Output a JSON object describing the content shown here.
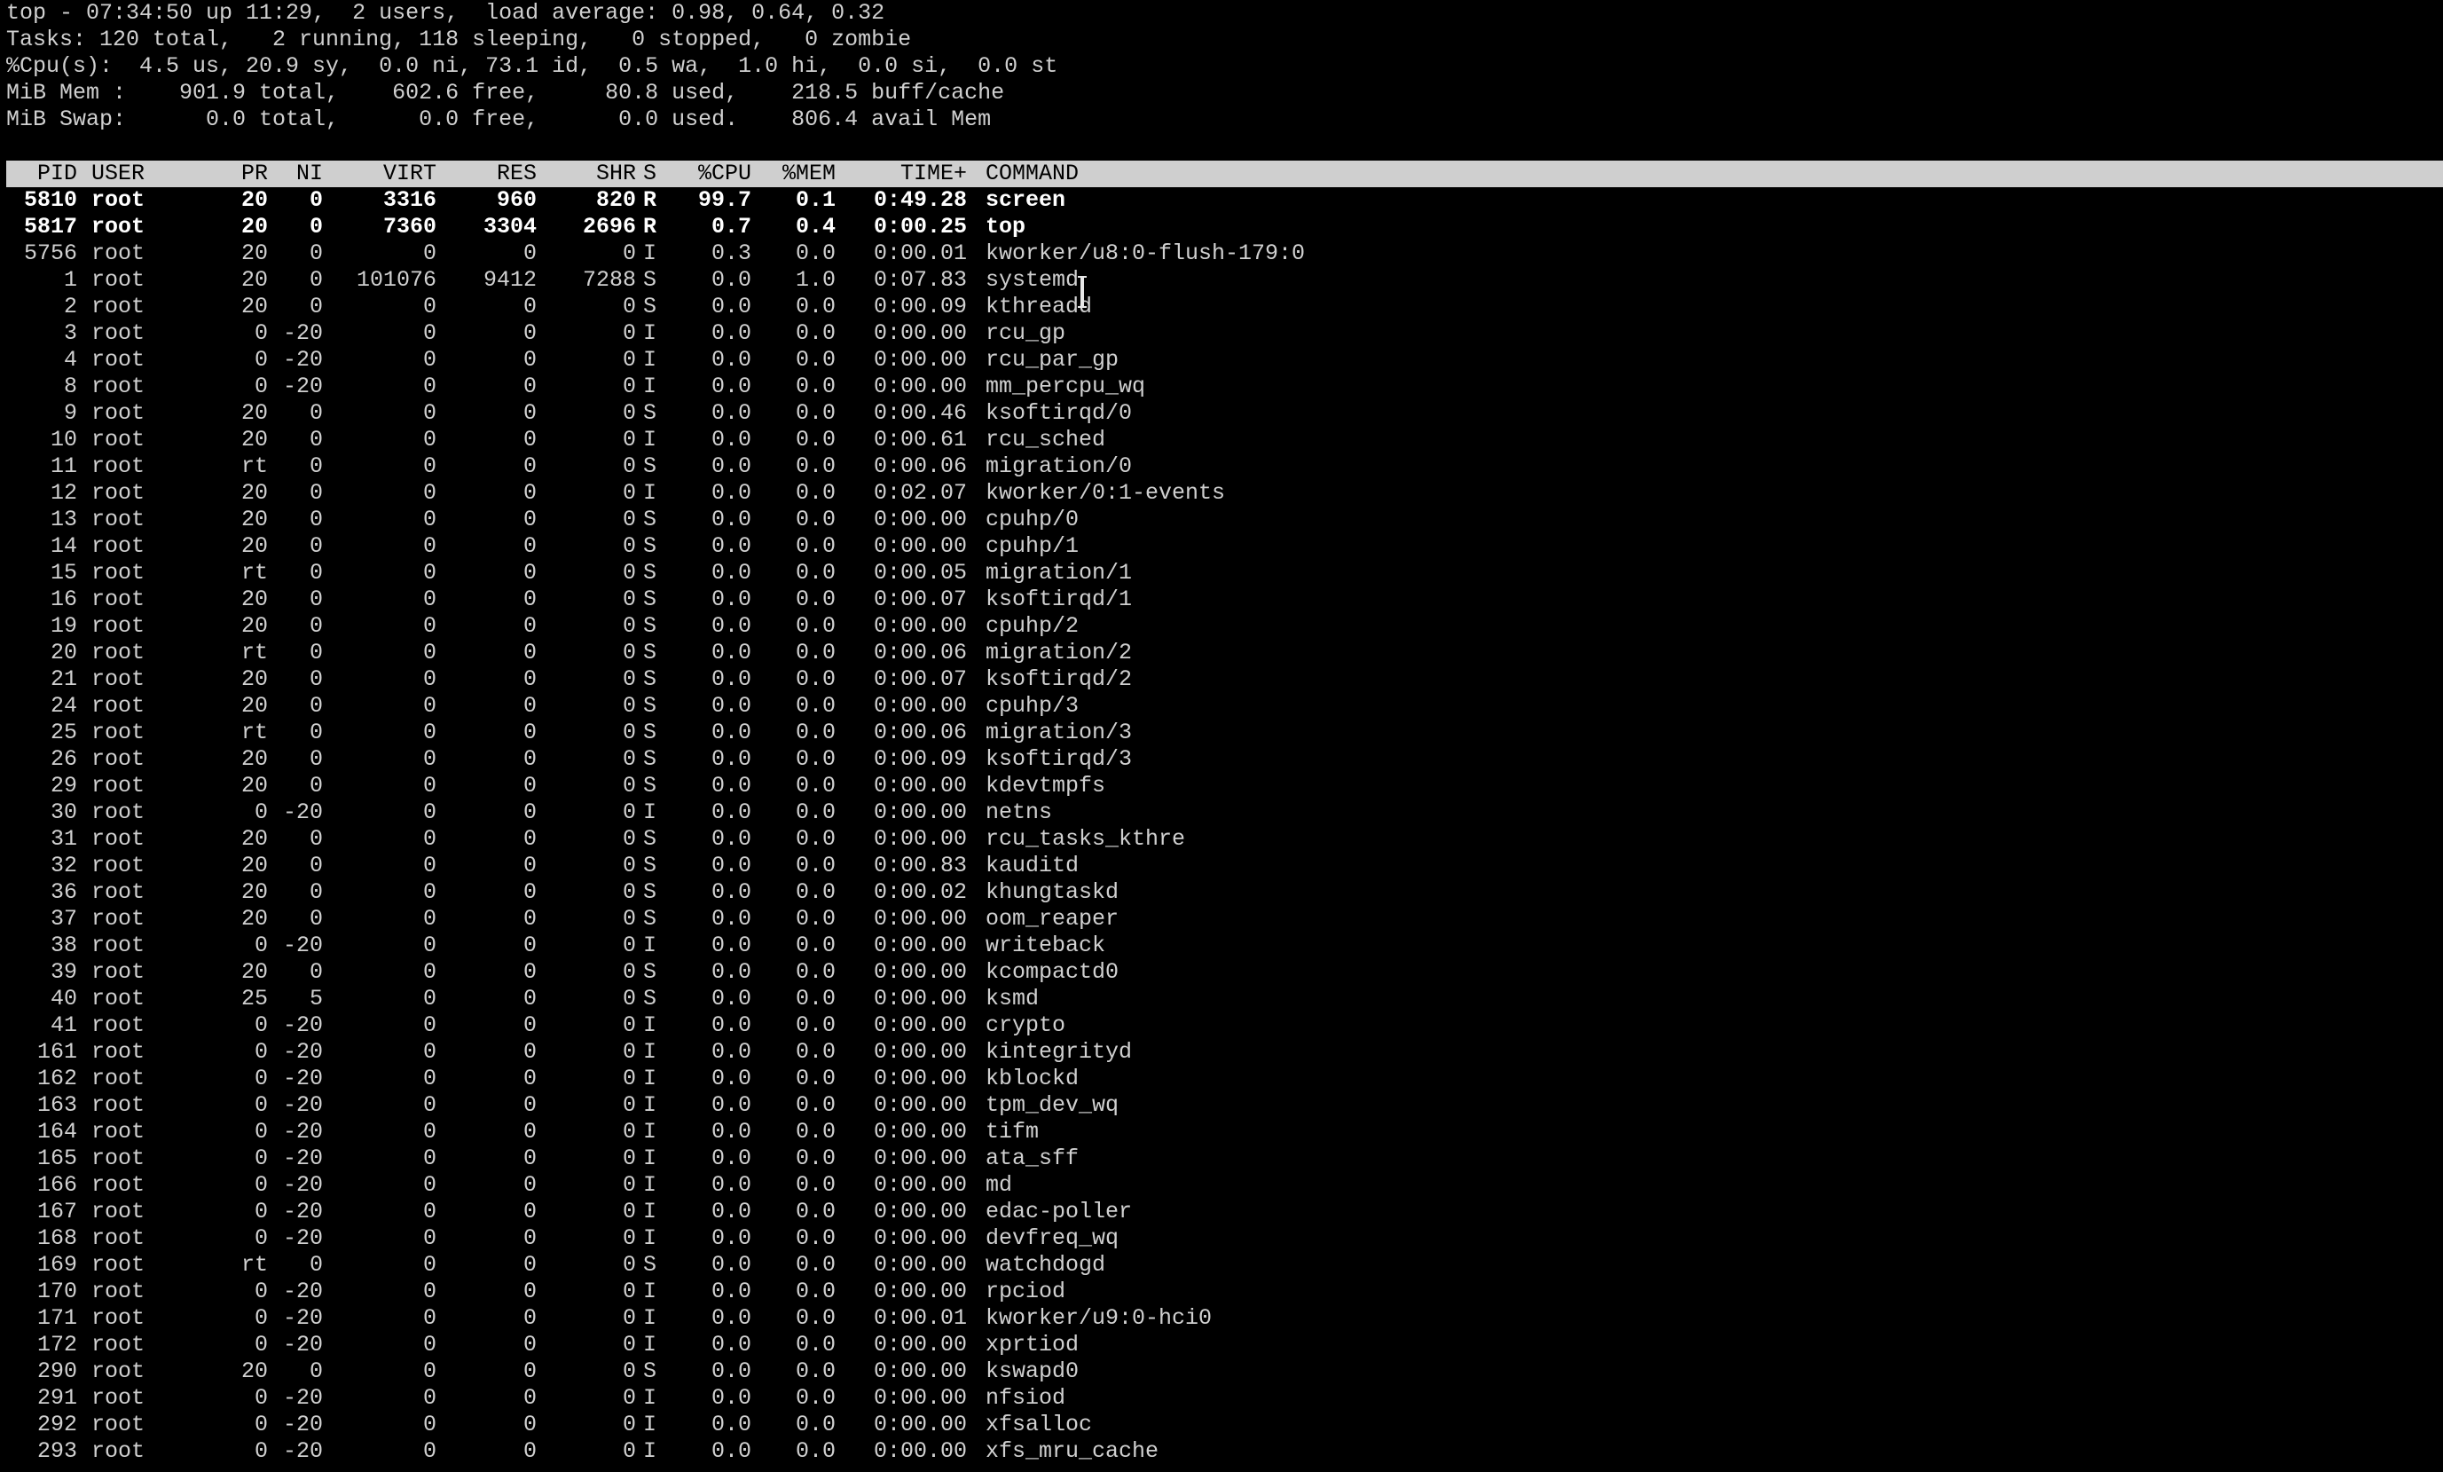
{
  "summary": {
    "line1": "top - 07:34:50 up 11:29,  2 users,  load average: 0.98, 0.64, 0.32",
    "line2": "Tasks: 120 total,   2 running, 118 sleeping,   0 stopped,   0 zombie",
    "line3": "%Cpu(s):  4.5 us, 20.9 sy,  0.0 ni, 73.1 id,  0.5 wa,  1.0 hi,  0.0 si,  0.0 st",
    "line4": "MiB Mem :    901.9 total,    602.6 free,     80.8 used,    218.5 buff/cache",
    "line5": "MiB Swap:      0.0 total,      0.0 free,      0.0 used.    806.4 avail Mem"
  },
  "columns": {
    "pid": "PID",
    "user": "USER",
    "pr": "PR",
    "ni": "NI",
    "virt": "VIRT",
    "res": "RES",
    "shr": "SHR",
    "s": "S",
    "cpu": "%CPU",
    "mem": "%MEM",
    "time": "TIME+",
    "command": "COMMAND"
  },
  "processes": [
    {
      "pid": "5810",
      "user": "root",
      "pr": "20",
      "ni": "0",
      "virt": "3316",
      "res": "960",
      "shr": "820",
      "s": "R",
      "cpu": "99.7",
      "mem": "0.1",
      "time": "0:49.28",
      "command": "screen",
      "hl": true
    },
    {
      "pid": "5817",
      "user": "root",
      "pr": "20",
      "ni": "0",
      "virt": "7360",
      "res": "3304",
      "shr": "2696",
      "s": "R",
      "cpu": "0.7",
      "mem": "0.4",
      "time": "0:00.25",
      "command": "top",
      "hl": true
    },
    {
      "pid": "5756",
      "user": "root",
      "pr": "20",
      "ni": "0",
      "virt": "0",
      "res": "0",
      "shr": "0",
      "s": "I",
      "cpu": "0.3",
      "mem": "0.0",
      "time": "0:00.01",
      "command": "kworker/u8:0-flush-179:0"
    },
    {
      "pid": "1",
      "user": "root",
      "pr": "20",
      "ni": "0",
      "virt": "101076",
      "res": "9412",
      "shr": "7288",
      "s": "S",
      "cpu": "0.0",
      "mem": "1.0",
      "time": "0:07.83",
      "command": "systemd"
    },
    {
      "pid": "2",
      "user": "root",
      "pr": "20",
      "ni": "0",
      "virt": "0",
      "res": "0",
      "shr": "0",
      "s": "S",
      "cpu": "0.0",
      "mem": "0.0",
      "time": "0:00.09",
      "command": "kthreadd"
    },
    {
      "pid": "3",
      "user": "root",
      "pr": "0",
      "ni": "-20",
      "virt": "0",
      "res": "0",
      "shr": "0",
      "s": "I",
      "cpu": "0.0",
      "mem": "0.0",
      "time": "0:00.00",
      "command": "rcu_gp"
    },
    {
      "pid": "4",
      "user": "root",
      "pr": "0",
      "ni": "-20",
      "virt": "0",
      "res": "0",
      "shr": "0",
      "s": "I",
      "cpu": "0.0",
      "mem": "0.0",
      "time": "0:00.00",
      "command": "rcu_par_gp"
    },
    {
      "pid": "8",
      "user": "root",
      "pr": "0",
      "ni": "-20",
      "virt": "0",
      "res": "0",
      "shr": "0",
      "s": "I",
      "cpu": "0.0",
      "mem": "0.0",
      "time": "0:00.00",
      "command": "mm_percpu_wq"
    },
    {
      "pid": "9",
      "user": "root",
      "pr": "20",
      "ni": "0",
      "virt": "0",
      "res": "0",
      "shr": "0",
      "s": "S",
      "cpu": "0.0",
      "mem": "0.0",
      "time": "0:00.46",
      "command": "ksoftirqd/0"
    },
    {
      "pid": "10",
      "user": "root",
      "pr": "20",
      "ni": "0",
      "virt": "0",
      "res": "0",
      "shr": "0",
      "s": "I",
      "cpu": "0.0",
      "mem": "0.0",
      "time": "0:00.61",
      "command": "rcu_sched"
    },
    {
      "pid": "11",
      "user": "root",
      "pr": "rt",
      "ni": "0",
      "virt": "0",
      "res": "0",
      "shr": "0",
      "s": "S",
      "cpu": "0.0",
      "mem": "0.0",
      "time": "0:00.06",
      "command": "migration/0"
    },
    {
      "pid": "12",
      "user": "root",
      "pr": "20",
      "ni": "0",
      "virt": "0",
      "res": "0",
      "shr": "0",
      "s": "I",
      "cpu": "0.0",
      "mem": "0.0",
      "time": "0:02.07",
      "command": "kworker/0:1-events"
    },
    {
      "pid": "13",
      "user": "root",
      "pr": "20",
      "ni": "0",
      "virt": "0",
      "res": "0",
      "shr": "0",
      "s": "S",
      "cpu": "0.0",
      "mem": "0.0",
      "time": "0:00.00",
      "command": "cpuhp/0"
    },
    {
      "pid": "14",
      "user": "root",
      "pr": "20",
      "ni": "0",
      "virt": "0",
      "res": "0",
      "shr": "0",
      "s": "S",
      "cpu": "0.0",
      "mem": "0.0",
      "time": "0:00.00",
      "command": "cpuhp/1"
    },
    {
      "pid": "15",
      "user": "root",
      "pr": "rt",
      "ni": "0",
      "virt": "0",
      "res": "0",
      "shr": "0",
      "s": "S",
      "cpu": "0.0",
      "mem": "0.0",
      "time": "0:00.05",
      "command": "migration/1"
    },
    {
      "pid": "16",
      "user": "root",
      "pr": "20",
      "ni": "0",
      "virt": "0",
      "res": "0",
      "shr": "0",
      "s": "S",
      "cpu": "0.0",
      "mem": "0.0",
      "time": "0:00.07",
      "command": "ksoftirqd/1"
    },
    {
      "pid": "19",
      "user": "root",
      "pr": "20",
      "ni": "0",
      "virt": "0",
      "res": "0",
      "shr": "0",
      "s": "S",
      "cpu": "0.0",
      "mem": "0.0",
      "time": "0:00.00",
      "command": "cpuhp/2"
    },
    {
      "pid": "20",
      "user": "root",
      "pr": "rt",
      "ni": "0",
      "virt": "0",
      "res": "0",
      "shr": "0",
      "s": "S",
      "cpu": "0.0",
      "mem": "0.0",
      "time": "0:00.06",
      "command": "migration/2"
    },
    {
      "pid": "21",
      "user": "root",
      "pr": "20",
      "ni": "0",
      "virt": "0",
      "res": "0",
      "shr": "0",
      "s": "S",
      "cpu": "0.0",
      "mem": "0.0",
      "time": "0:00.07",
      "command": "ksoftirqd/2"
    },
    {
      "pid": "24",
      "user": "root",
      "pr": "20",
      "ni": "0",
      "virt": "0",
      "res": "0",
      "shr": "0",
      "s": "S",
      "cpu": "0.0",
      "mem": "0.0",
      "time": "0:00.00",
      "command": "cpuhp/3"
    },
    {
      "pid": "25",
      "user": "root",
      "pr": "rt",
      "ni": "0",
      "virt": "0",
      "res": "0",
      "shr": "0",
      "s": "S",
      "cpu": "0.0",
      "mem": "0.0",
      "time": "0:00.06",
      "command": "migration/3"
    },
    {
      "pid": "26",
      "user": "root",
      "pr": "20",
      "ni": "0",
      "virt": "0",
      "res": "0",
      "shr": "0",
      "s": "S",
      "cpu": "0.0",
      "mem": "0.0",
      "time": "0:00.09",
      "command": "ksoftirqd/3"
    },
    {
      "pid": "29",
      "user": "root",
      "pr": "20",
      "ni": "0",
      "virt": "0",
      "res": "0",
      "shr": "0",
      "s": "S",
      "cpu": "0.0",
      "mem": "0.0",
      "time": "0:00.00",
      "command": "kdevtmpfs"
    },
    {
      "pid": "30",
      "user": "root",
      "pr": "0",
      "ni": "-20",
      "virt": "0",
      "res": "0",
      "shr": "0",
      "s": "I",
      "cpu": "0.0",
      "mem": "0.0",
      "time": "0:00.00",
      "command": "netns"
    },
    {
      "pid": "31",
      "user": "root",
      "pr": "20",
      "ni": "0",
      "virt": "0",
      "res": "0",
      "shr": "0",
      "s": "S",
      "cpu": "0.0",
      "mem": "0.0",
      "time": "0:00.00",
      "command": "rcu_tasks_kthre"
    },
    {
      "pid": "32",
      "user": "root",
      "pr": "20",
      "ni": "0",
      "virt": "0",
      "res": "0",
      "shr": "0",
      "s": "S",
      "cpu": "0.0",
      "mem": "0.0",
      "time": "0:00.83",
      "command": "kauditd"
    },
    {
      "pid": "36",
      "user": "root",
      "pr": "20",
      "ni": "0",
      "virt": "0",
      "res": "0",
      "shr": "0",
      "s": "S",
      "cpu": "0.0",
      "mem": "0.0",
      "time": "0:00.02",
      "command": "khungtaskd"
    },
    {
      "pid": "37",
      "user": "root",
      "pr": "20",
      "ni": "0",
      "virt": "0",
      "res": "0",
      "shr": "0",
      "s": "S",
      "cpu": "0.0",
      "mem": "0.0",
      "time": "0:00.00",
      "command": "oom_reaper"
    },
    {
      "pid": "38",
      "user": "root",
      "pr": "0",
      "ni": "-20",
      "virt": "0",
      "res": "0",
      "shr": "0",
      "s": "I",
      "cpu": "0.0",
      "mem": "0.0",
      "time": "0:00.00",
      "command": "writeback"
    },
    {
      "pid": "39",
      "user": "root",
      "pr": "20",
      "ni": "0",
      "virt": "0",
      "res": "0",
      "shr": "0",
      "s": "S",
      "cpu": "0.0",
      "mem": "0.0",
      "time": "0:00.00",
      "command": "kcompactd0"
    },
    {
      "pid": "40",
      "user": "root",
      "pr": "25",
      "ni": "5",
      "virt": "0",
      "res": "0",
      "shr": "0",
      "s": "S",
      "cpu": "0.0",
      "mem": "0.0",
      "time": "0:00.00",
      "command": "ksmd"
    },
    {
      "pid": "41",
      "user": "root",
      "pr": "0",
      "ni": "-20",
      "virt": "0",
      "res": "0",
      "shr": "0",
      "s": "I",
      "cpu": "0.0",
      "mem": "0.0",
      "time": "0:00.00",
      "command": "crypto"
    },
    {
      "pid": "161",
      "user": "root",
      "pr": "0",
      "ni": "-20",
      "virt": "0",
      "res": "0",
      "shr": "0",
      "s": "I",
      "cpu": "0.0",
      "mem": "0.0",
      "time": "0:00.00",
      "command": "kintegrityd"
    },
    {
      "pid": "162",
      "user": "root",
      "pr": "0",
      "ni": "-20",
      "virt": "0",
      "res": "0",
      "shr": "0",
      "s": "I",
      "cpu": "0.0",
      "mem": "0.0",
      "time": "0:00.00",
      "command": "kblockd"
    },
    {
      "pid": "163",
      "user": "root",
      "pr": "0",
      "ni": "-20",
      "virt": "0",
      "res": "0",
      "shr": "0",
      "s": "I",
      "cpu": "0.0",
      "mem": "0.0",
      "time": "0:00.00",
      "command": "tpm_dev_wq"
    },
    {
      "pid": "164",
      "user": "root",
      "pr": "0",
      "ni": "-20",
      "virt": "0",
      "res": "0",
      "shr": "0",
      "s": "I",
      "cpu": "0.0",
      "mem": "0.0",
      "time": "0:00.00",
      "command": "tifm"
    },
    {
      "pid": "165",
      "user": "root",
      "pr": "0",
      "ni": "-20",
      "virt": "0",
      "res": "0",
      "shr": "0",
      "s": "I",
      "cpu": "0.0",
      "mem": "0.0",
      "time": "0:00.00",
      "command": "ata_sff"
    },
    {
      "pid": "166",
      "user": "root",
      "pr": "0",
      "ni": "-20",
      "virt": "0",
      "res": "0",
      "shr": "0",
      "s": "I",
      "cpu": "0.0",
      "mem": "0.0",
      "time": "0:00.00",
      "command": "md"
    },
    {
      "pid": "167",
      "user": "root",
      "pr": "0",
      "ni": "-20",
      "virt": "0",
      "res": "0",
      "shr": "0",
      "s": "I",
      "cpu": "0.0",
      "mem": "0.0",
      "time": "0:00.00",
      "command": "edac-poller"
    },
    {
      "pid": "168",
      "user": "root",
      "pr": "0",
      "ni": "-20",
      "virt": "0",
      "res": "0",
      "shr": "0",
      "s": "I",
      "cpu": "0.0",
      "mem": "0.0",
      "time": "0:00.00",
      "command": "devfreq_wq"
    },
    {
      "pid": "169",
      "user": "root",
      "pr": "rt",
      "ni": "0",
      "virt": "0",
      "res": "0",
      "shr": "0",
      "s": "S",
      "cpu": "0.0",
      "mem": "0.0",
      "time": "0:00.00",
      "command": "watchdogd"
    },
    {
      "pid": "170",
      "user": "root",
      "pr": "0",
      "ni": "-20",
      "virt": "0",
      "res": "0",
      "shr": "0",
      "s": "I",
      "cpu": "0.0",
      "mem": "0.0",
      "time": "0:00.00",
      "command": "rpciod"
    },
    {
      "pid": "171",
      "user": "root",
      "pr": "0",
      "ni": "-20",
      "virt": "0",
      "res": "0",
      "shr": "0",
      "s": "I",
      "cpu": "0.0",
      "mem": "0.0",
      "time": "0:00.01",
      "command": "kworker/u9:0-hci0"
    },
    {
      "pid": "172",
      "user": "root",
      "pr": "0",
      "ni": "-20",
      "virt": "0",
      "res": "0",
      "shr": "0",
      "s": "I",
      "cpu": "0.0",
      "mem": "0.0",
      "time": "0:00.00",
      "command": "xprtiod"
    },
    {
      "pid": "290",
      "user": "root",
      "pr": "20",
      "ni": "0",
      "virt": "0",
      "res": "0",
      "shr": "0",
      "s": "S",
      "cpu": "0.0",
      "mem": "0.0",
      "time": "0:00.00",
      "command": "kswapd0"
    },
    {
      "pid": "291",
      "user": "root",
      "pr": "0",
      "ni": "-20",
      "virt": "0",
      "res": "0",
      "shr": "0",
      "s": "I",
      "cpu": "0.0",
      "mem": "0.0",
      "time": "0:00.00",
      "command": "nfsiod"
    },
    {
      "pid": "292",
      "user": "root",
      "pr": "0",
      "ni": "-20",
      "virt": "0",
      "res": "0",
      "shr": "0",
      "s": "I",
      "cpu": "0.0",
      "mem": "0.0",
      "time": "0:00.00",
      "command": "xfsalloc"
    },
    {
      "pid": "293",
      "user": "root",
      "pr": "0",
      "ni": "-20",
      "virt": "0",
      "res": "0",
      "shr": "0",
      "s": "I",
      "cpu": "0.0",
      "mem": "0.0",
      "time": "0:00.00",
      "command": "xfs_mru_cache"
    }
  ],
  "cursor": {
    "icon": "text-ibeam-cursor-icon"
  },
  "colors": {
    "background": "#000000",
    "text": "#d0d0d0",
    "header_bar": "#cfcfcf",
    "highlight_text": "#ffffff"
  }
}
